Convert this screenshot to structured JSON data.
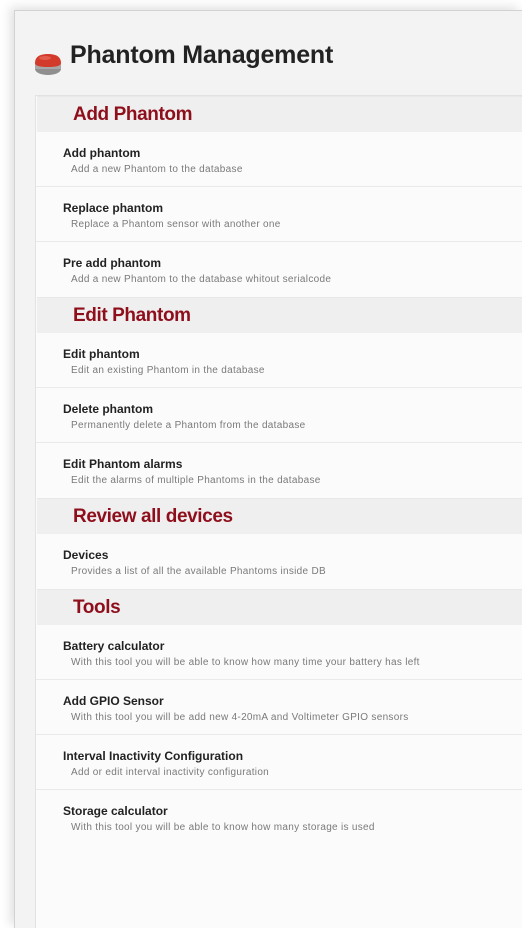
{
  "header": {
    "title": "Phantom Management",
    "logo_icon": "phantom-sensor-icon"
  },
  "colors": {
    "section_title": "#8e0f1b",
    "logo_red": "#d23a2a",
    "logo_grey": "#9a9a9a"
  },
  "sections": [
    {
      "title": "Add Phantom",
      "items": [
        {
          "title": "Add phantom",
          "desc": "Add a new Phantom to the database"
        },
        {
          "title": "Replace phantom",
          "desc": "Replace a Phantom sensor with another one"
        },
        {
          "title": "Pre add phantom",
          "desc": "Add a new Phantom to the database whitout serialcode"
        }
      ]
    },
    {
      "title": "Edit Phantom",
      "items": [
        {
          "title": "Edit phantom",
          "desc": "Edit an existing Phantom in the database"
        },
        {
          "title": "Delete phantom",
          "desc": "Permanently delete a Phantom from the database"
        },
        {
          "title": "Edit Phantom alarms",
          "desc": "Edit the alarms of multiple Phantoms in the database"
        }
      ]
    },
    {
      "title": "Review all devices",
      "items": [
        {
          "title": "Devices",
          "desc": "Provides a list of all the available Phantoms inside DB"
        }
      ]
    },
    {
      "title": "Tools",
      "items": [
        {
          "title": "Battery calculator",
          "desc": "With this tool you will be able to know how many time your battery has left"
        },
        {
          "title": "Add GPIO Sensor",
          "desc": "With this tool you will be add new 4-20mA and Voltimeter GPIO sensors"
        },
        {
          "title": "Interval Inactivity Configuration",
          "desc": "Add or edit interval inactivity configuration"
        },
        {
          "title": "Storage calculator",
          "desc": "With this tool you will be able to know how many storage is used"
        }
      ]
    }
  ]
}
